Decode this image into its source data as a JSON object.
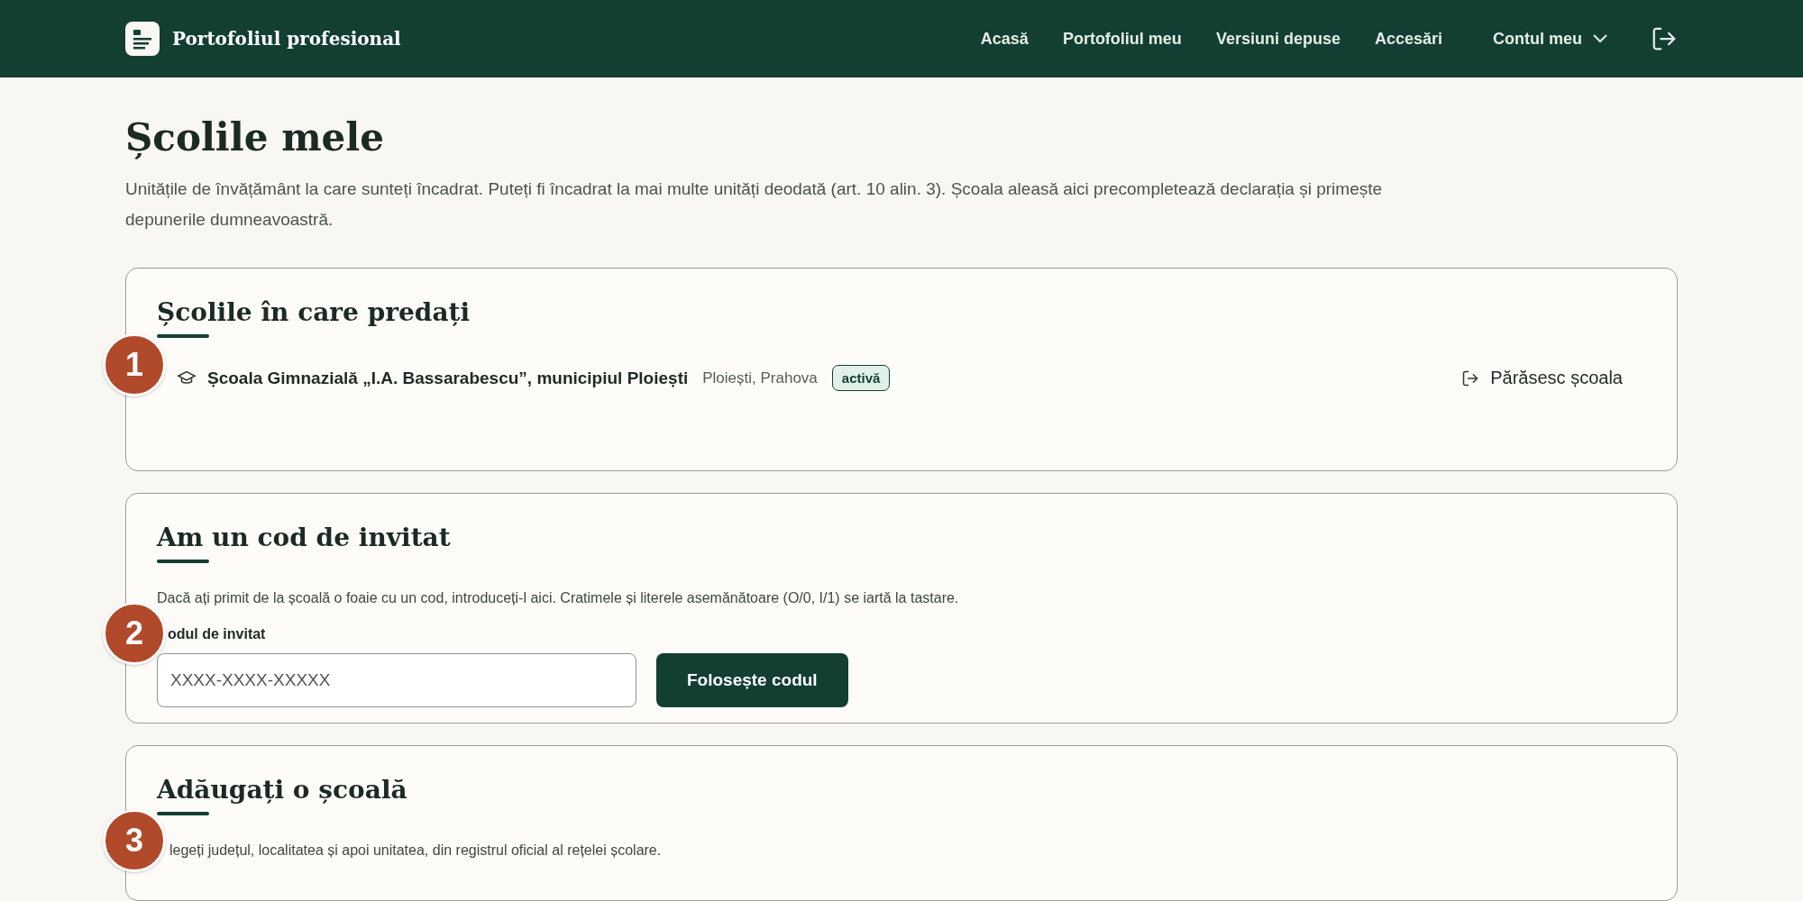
{
  "header": {
    "brand": "Portofoliul profesional",
    "nav": [
      {
        "label": "Acasă",
        "kind": "link"
      },
      {
        "label": "Portofoliul meu",
        "kind": "link"
      },
      {
        "label": "Versiuni depuse",
        "kind": "link"
      },
      {
        "label": "Accesări",
        "kind": "link"
      },
      {
        "label": "Contul meu",
        "kind": "menu"
      }
    ]
  },
  "page": {
    "title": "Școlile mele",
    "description": "Unitățile de învățământ la care sunteți încadrat. Puteți fi încadrat la mai multe unități deodată (art. 10 alin. 3). Școala aleasă aici precompletează declarația și primește depunerile dumneavoastră."
  },
  "schools_card": {
    "badge": "1",
    "title": "Școlile în care predați",
    "schools": [
      {
        "name": "Școala Gimnazială „I.A. Bassarabescu”, municipiul Ploiești",
        "location": "Ploiești, Prahova",
        "status": "activă",
        "action": "Părăsesc școala"
      }
    ]
  },
  "invite_card": {
    "badge": "2",
    "title": "Am un cod de invitat",
    "hint": "Dacă ați primit de la școală o foaie cu un cod, introduceți-l aici. Cratimele și literele asemănătoare (O/0, I/1) se iartă la tastare.",
    "field_label": "odul de invitat",
    "placeholder": "XXXX-XXXX-XXXXX",
    "button": "Folosește codul"
  },
  "add_card": {
    "badge": "3",
    "title": "Adăugați o școală",
    "hint": "legeți județul, localitatea și apoi unitatea, din registrul oficial al rețelei școlare."
  }
}
